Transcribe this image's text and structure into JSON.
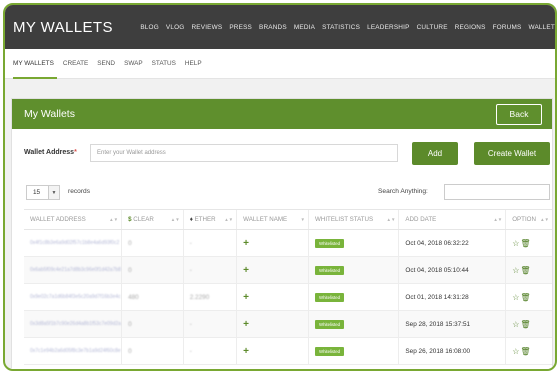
{
  "brand": "MY WALLETS",
  "top_nav": [
    "BLOG",
    "VLOG",
    "REVIEWS",
    "PRESS",
    "BRANDS",
    "MEDIA",
    "STATISTICS",
    "LEADERSHIP",
    "CULTURE",
    "REGIONS",
    "FORUMS",
    "WALLET"
  ],
  "sub_nav": [
    "MY WALLETS",
    "CREATE",
    "SEND",
    "SWAP",
    "STATUS",
    "HELP"
  ],
  "card": {
    "title": "My Wallets",
    "back_label": "Back"
  },
  "address_form": {
    "label": "Wallet Address",
    "required_mark": "*",
    "placeholder": "Enter your Wallet address",
    "add_label": "Add",
    "create_label": "Create Wallet"
  },
  "records": {
    "value": "15",
    "label": "records",
    "search_label": "Search Anything:"
  },
  "table": {
    "headers": [
      "WALLET ADDRESS",
      "CLEAR",
      "ETHER",
      "WALLET NAME",
      "WHITELIST STATUS",
      "ADD DATE",
      "OPTION"
    ],
    "rows": [
      {
        "address": "0x4f1c8b3e6a9d02f57c1b8e4a6d93f0c2",
        "clear": "0",
        "ether": "-",
        "name_icon": "+",
        "status": "Whitelisted",
        "date": "Oct 04, 2018 06:32:22"
      },
      {
        "address": "0x6ab5f09c4e21a7d8b3c96e0f1d42a7b8",
        "clear": "0",
        "ether": "-",
        "name_icon": "+",
        "status": "Whitelisted",
        "date": "Oct 04, 2018 05:10:44"
      },
      {
        "address": "0x9e02c7a1d6b84f3e5c20a9d7f16b3e4c",
        "clear": "480",
        "ether": "2.2290",
        "name_icon": "+",
        "status": "Whitelisted",
        "date": "Oct 01, 2018 14:31:28"
      },
      {
        "address": "0x3d8a5f1b7c90e26d4a8b1f53c7e09d2a",
        "clear": "0",
        "ether": "-",
        "name_icon": "+",
        "status": "Whitelisted",
        "date": "Sep 28, 2018 15:37:51"
      },
      {
        "address": "0x7c1e94b2a6d05f8c3e7b1a9d24f60c8e",
        "clear": "0",
        "ether": "-",
        "name_icon": "+",
        "status": "Whitelisted",
        "date": "Sep 26, 2018 16:08:00"
      }
    ]
  },
  "icons": {
    "clear": "clear-token-icon",
    "ether": "ether-diamond-icon",
    "option_star": "star-icon",
    "option_delete": "trash-icon"
  },
  "colors": {
    "accent": "#5f8f2d",
    "button": "#5c8a2a",
    "topbar": "#3e3e3e",
    "badge": "#79b43b"
  }
}
